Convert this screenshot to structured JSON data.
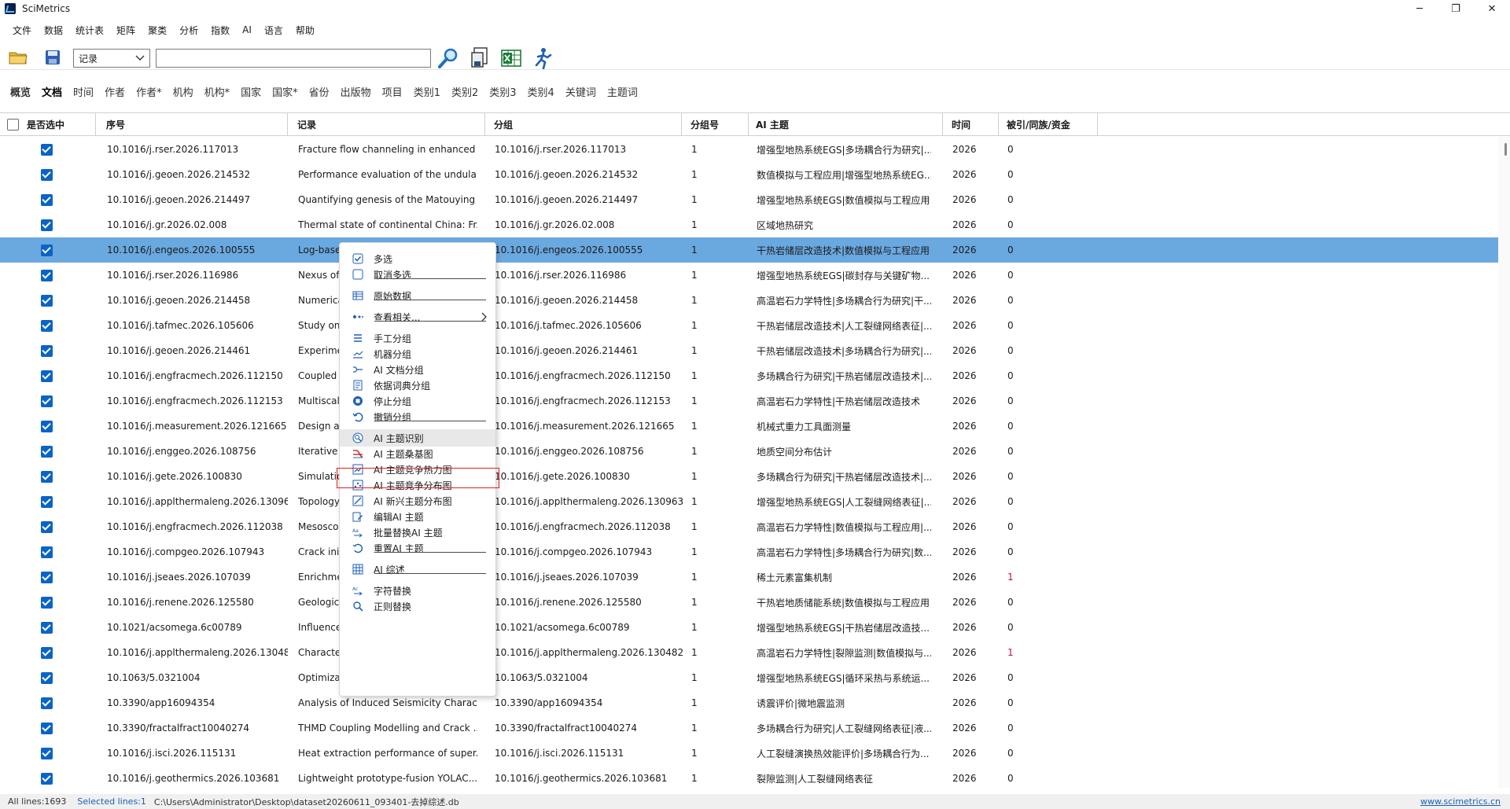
{
  "window": {
    "title": "SciMetrics",
    "min": "─",
    "max": "❐",
    "close": "✕"
  },
  "menu": [
    "文件",
    "数据",
    "统计表",
    "矩阵",
    "聚类",
    "分析",
    "指数",
    "AI",
    "语言",
    "帮助"
  ],
  "toolbar": {
    "combo_value": "记录",
    "search_value": ""
  },
  "tabs": [
    "概览",
    "文档",
    "时间",
    "作者",
    "作者*",
    "机构",
    "机构*",
    "国家",
    "国家*",
    "省份",
    "出版物",
    "项目",
    "类别1",
    "类别2",
    "类别3",
    "类别4",
    "关键词",
    "主题词"
  ],
  "active_tab_index": 1,
  "grid": {
    "headers": {
      "selected": "是否选中",
      "seq": "序号",
      "record": "记录",
      "group": "分组",
      "group_no": "分组号",
      "ai_topic": "AI 主题",
      "year": "时间",
      "cited": "被引/同族/资金"
    },
    "rows": [
      {
        "seq": "10.1016/j.rser.2026.117013",
        "record": "Fracture flow channeling in enhanced ...",
        "group": "10.1016/j.rser.2026.117013",
        "group_no": "1",
        "ai": "增强型地热系统EGS|多场耦合行为研究|...",
        "year": "2026",
        "cited": "0"
      },
      {
        "seq": "10.1016/j.geoen.2026.214532",
        "record": "Performance evaluation of the undula...",
        "group": "10.1016/j.geoen.2026.214532",
        "group_no": "1",
        "ai": "数值模拟与工程应用|增强型地热系统EG...",
        "year": "2026",
        "cited": "0"
      },
      {
        "seq": "10.1016/j.geoen.2026.214497",
        "record": "Quantifying genesis of the Matouying ...",
        "group": "10.1016/j.geoen.2026.214497",
        "group_no": "1",
        "ai": "增强型地热系统EGS|数值模拟与工程应用",
        "year": "2026",
        "cited": "0"
      },
      {
        "seq": "10.1016/j.gr.2026.02.008",
        "record": "Thermal state of continental China: Fr...",
        "group": "10.1016/j.gr.2026.02.008",
        "group_no": "1",
        "ai": "区域地热研究",
        "year": "2026",
        "cited": "0"
      },
      {
        "seq": "10.1016/j.engeos.2026.100555",
        "record": "Log-base",
        "group": "10.1016/j.engeos.2026.100555",
        "group_no": "1",
        "ai": "干热岩储层改造技术|数值模拟与工程应用",
        "year": "2026",
        "cited": "0",
        "selected": true
      },
      {
        "seq": "10.1016/j.rser.2026.116986",
        "record": "Nexus of",
        "group": "10.1016/j.rser.2026.116986",
        "group_no": "1",
        "ai": "增强型地热系统EGS|碳封存与关键矿物...",
        "year": "2026",
        "cited": "0"
      },
      {
        "seq": "10.1016/j.geoen.2026.214458",
        "record": "Numerica",
        "group": "10.1016/j.geoen.2026.214458",
        "group_no": "1",
        "ai": "高温岩石力学特性|多场耦合行为研究|干...",
        "year": "2026",
        "cited": "0"
      },
      {
        "seq": "10.1016/j.tafmec.2026.105606",
        "record": "Study on",
        "group": "10.1016/j.tafmec.2026.105606",
        "group_no": "1",
        "ai": "干热岩储层改造技术|人工裂缝网络表征|...",
        "year": "2026",
        "cited": "0"
      },
      {
        "seq": "10.1016/j.geoen.2026.214461",
        "record": "Experime",
        "group": "10.1016/j.geoen.2026.214461",
        "group_no": "1",
        "ai": "干热岩储层改造技术|多场耦合行为研究|...",
        "year": "2026",
        "cited": "0"
      },
      {
        "seq": "10.1016/j.engfracmech.2026.112150",
        "record": "Coupled",
        "group": "10.1016/j.engfracmech.2026.112150",
        "group_no": "1",
        "ai": "多场耦合行为研究|干热岩储层改造技术|...",
        "year": "2026",
        "cited": "0"
      },
      {
        "seq": "10.1016/j.engfracmech.2026.112153",
        "record": "Multiscal",
        "group": "10.1016/j.engfracmech.2026.112153",
        "group_no": "1",
        "ai": "高温岩石力学特性|干热岩储层改造技术",
        "year": "2026",
        "cited": "0"
      },
      {
        "seq": "10.1016/j.measurement.2026.121665",
        "record": "Design an",
        "group": "10.1016/j.measurement.2026.121665",
        "group_no": "1",
        "ai": "机械式重力工具面测量",
        "year": "2026",
        "cited": "0"
      },
      {
        "seq": "10.1016/j.enggeo.2026.108756",
        "record": "Iterative i",
        "group": "10.1016/j.enggeo.2026.108756",
        "group_no": "1",
        "ai": "地质空间分布估计",
        "year": "2026",
        "cited": "0"
      },
      {
        "seq": "10.1016/j.gete.2026.100830",
        "record": "Simulatio",
        "group": "10.1016/j.gete.2026.100830",
        "group_no": "1",
        "ai": "多场耦合行为研究|干热岩储层改造技术|...",
        "year": "2026",
        "cited": "0"
      },
      {
        "seq": "10.1016/j.applthermaleng.2026.130963",
        "record": "Topology",
        "group": "10.1016/j.applthermaleng.2026.130963",
        "group_no": "1",
        "ai": "增强型地热系统EGS|人工裂缝网络表征|...",
        "year": "2026",
        "cited": "0"
      },
      {
        "seq": "10.1016/j.engfracmech.2026.112038",
        "record": "Mesosco",
        "group": "10.1016/j.engfracmech.2026.112038",
        "group_no": "1",
        "ai": "高温岩石力学特性|数值模拟与工程应用|...",
        "year": "2026",
        "cited": "0"
      },
      {
        "seq": "10.1016/j.compgeo.2026.107943",
        "record": "Crack init",
        "group": "10.1016/j.compgeo.2026.107943",
        "group_no": "1",
        "ai": "高温岩石力学特性|多场耦合行为研究|数...",
        "year": "2026",
        "cited": "0"
      },
      {
        "seq": "10.1016/j.jseaes.2026.107039",
        "record": "Enrichme",
        "group": "10.1016/j.jseaes.2026.107039",
        "group_no": "1",
        "ai": "稀土元素富集机制",
        "year": "2026",
        "cited": "1"
      },
      {
        "seq": "10.1016/j.renene.2026.125580",
        "record": "Geologic",
        "group": "10.1016/j.renene.2026.125580",
        "group_no": "1",
        "ai": "干热岩地质储能系统|数值模拟与工程应用",
        "year": "2026",
        "cited": "0"
      },
      {
        "seq": "10.1021/acsomega.6c00789",
        "record": "Influence",
        "group": "10.1021/acsomega.6c00789",
        "group_no": "1",
        "ai": "增强型地热系统EGS|干热岩储层改造技...",
        "year": "2026",
        "cited": "0"
      },
      {
        "seq": "10.1016/j.applthermaleng.2026.130482",
        "record": "Characte",
        "group": "10.1016/j.applthermaleng.2026.130482",
        "group_no": "1",
        "ai": "高温岩石力学特性|裂隙监测|数值模拟与...",
        "year": "2026",
        "cited": "1"
      },
      {
        "seq": "10.1063/5.0321004",
        "record": "Optimiza",
        "group": "10.1063/5.0321004",
        "group_no": "1",
        "ai": "增强型地热系统EGS|循环采热与系统运...",
        "year": "2026",
        "cited": "0"
      },
      {
        "seq": "10.3390/app16094354",
        "record": "Analysis of Induced Seismicity Charac...",
        "group": "10.3390/app16094354",
        "group_no": "1",
        "ai": "诱震评价|微地震监测",
        "year": "2026",
        "cited": "0"
      },
      {
        "seq": "10.3390/fractalfract10040274",
        "record": "THMD Coupling Modelling and Crack ...",
        "group": "10.3390/fractalfract10040274",
        "group_no": "1",
        "ai": "多场耦合行为研究|人工裂缝网络表征|液...",
        "year": "2026",
        "cited": "0"
      },
      {
        "seq": "10.1016/j.isci.2026.115131",
        "record": "Heat extraction performance of super...",
        "group": "10.1016/j.isci.2026.115131",
        "group_no": "1",
        "ai": "人工裂缝演换热效能评价|多场耦合行为...",
        "year": "2026",
        "cited": "0"
      },
      {
        "seq": "10.1016/j.geothermics.2026.103681",
        "record": "Lightweight prototype-fusion YOLAC...",
        "group": "10.1016/j.geothermics.2026.103681",
        "group_no": "1",
        "ai": "裂隙监测|人工裂缝网络表征",
        "year": "2026",
        "cited": "0"
      }
    ]
  },
  "context_menu": {
    "items": [
      {
        "label": "多选",
        "icon": "checkbox-checked-icon"
      },
      {
        "label": "取消多选",
        "icon": "checkbox-empty-icon"
      },
      {
        "label": "原始数据",
        "icon": "table-icon"
      },
      {
        "label": "查看相关...",
        "icon": "link-dots-icon",
        "submenu": true
      },
      {
        "label": "手工分组",
        "icon": "list-icon"
      },
      {
        "label": "机器分组",
        "icon": "chart-lines-icon"
      },
      {
        "label": "AI 文档分组",
        "icon": "ai-group-icon"
      },
      {
        "label": "依据词典分组",
        "icon": "dictionary-icon"
      },
      {
        "label": "停止分组",
        "icon": "stop-icon"
      },
      {
        "label": "撤销分组",
        "icon": "undo-icon"
      },
      {
        "label": "AI 主题识别",
        "icon": "ai-topic-icon",
        "highlighted": true
      },
      {
        "label": "AI 主题桑基图",
        "icon": "sankey-icon"
      },
      {
        "label": "AI 主题竞争热力图",
        "icon": "heatmap-icon"
      },
      {
        "label": "AI 主题竞争分布图",
        "icon": "scatter-icon"
      },
      {
        "label": "AI 新兴主题分布图",
        "icon": "trend-icon"
      },
      {
        "label": "编辑AI 主题",
        "icon": "edit-icon"
      },
      {
        "label": "批量替换AI 主题",
        "icon": "batch-replace-icon"
      },
      {
        "label": "重置AI 主题",
        "icon": "reset-icon"
      },
      {
        "label": "AI 综述",
        "icon": "grid-icon"
      },
      {
        "label": "字符替换",
        "icon": "replace-text-icon"
      },
      {
        "label": "正则替换",
        "icon": "regex-search-icon"
      }
    ]
  },
  "status": {
    "all_lines": "All lines:1693",
    "selected_lines": "Selected lines:1",
    "path": "C:\\Users\\Administrator\\Desktop\\dataset20260611_093401-去掉综述.db",
    "website": "www.scimetrics.cn"
  },
  "colors": {
    "selection": "#6aa8e0",
    "checkbox": "#0a64c8",
    "highlight_box": "#e0201e",
    "link": "#1b5fb5"
  }
}
